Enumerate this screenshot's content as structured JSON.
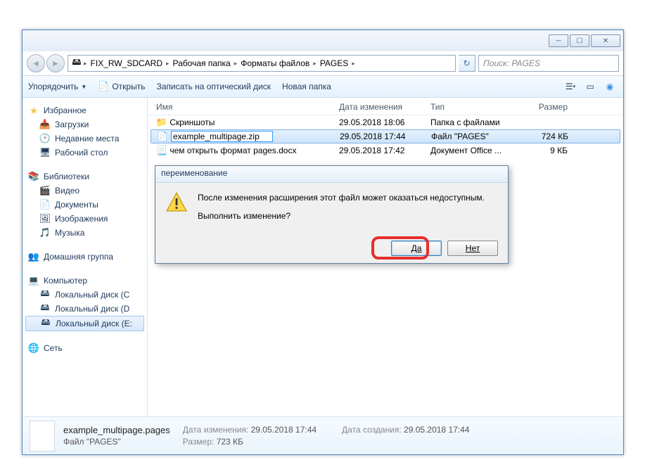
{
  "breadcrumbs": [
    "FIX_RW_SDCARD",
    "Рабочая папка",
    "Форматы файлов",
    "PAGES"
  ],
  "search_placeholder": "Поиск: PAGES",
  "toolbar": {
    "organize": "Упорядочить",
    "open": "Открыть",
    "burn": "Записать на оптический диск",
    "newfolder": "Новая папка"
  },
  "sidebar": {
    "favorites": "Избранное",
    "fav_items": [
      "Загрузки",
      "Недавние места",
      "Рабочий стол"
    ],
    "libraries": "Библиотеки",
    "lib_items": [
      "Видео",
      "Документы",
      "Изображения",
      "Музыка"
    ],
    "homegroup": "Домашняя группа",
    "computer": "Компьютер",
    "comp_items": [
      "Локальный диск (C",
      "Локальный диск (D",
      "Локальный диск (E:"
    ],
    "network": "Сеть"
  },
  "columns": {
    "name": "Имя",
    "date": "Дата изменения",
    "type": "Тип",
    "size": "Размер"
  },
  "files": [
    {
      "icon": "folder",
      "name": "Скриншоты",
      "date": "29.05.2018 18:06",
      "type": "Папка с файлами",
      "size": ""
    },
    {
      "icon": "file",
      "name": "example_multipage.zip",
      "date": "29.05.2018 17:44",
      "type": "Файл \"PAGES\"",
      "size": "724 КБ",
      "editing": true
    },
    {
      "icon": "docx",
      "name": "чем открыть формат pages.docx",
      "date": "29.05.2018 17:42",
      "type": "Документ Office ...",
      "size": "9 КБ"
    }
  ],
  "dialog": {
    "title": "переименование",
    "line1": "После изменения расширения этот файл может оказаться недоступным.",
    "line2": "Выполнить изменение?",
    "yes": "Да",
    "no": "Нет"
  },
  "details": {
    "filename": "example_multipage.pages",
    "filetype": "Файл \"PAGES\"",
    "mod_label": "Дата изменения:",
    "mod_value": "29.05.2018 17:44",
    "size_label": "Размер:",
    "size_value": "723 КБ",
    "created_label": "Дата создания:",
    "created_value": "29.05.2018 17:44"
  }
}
